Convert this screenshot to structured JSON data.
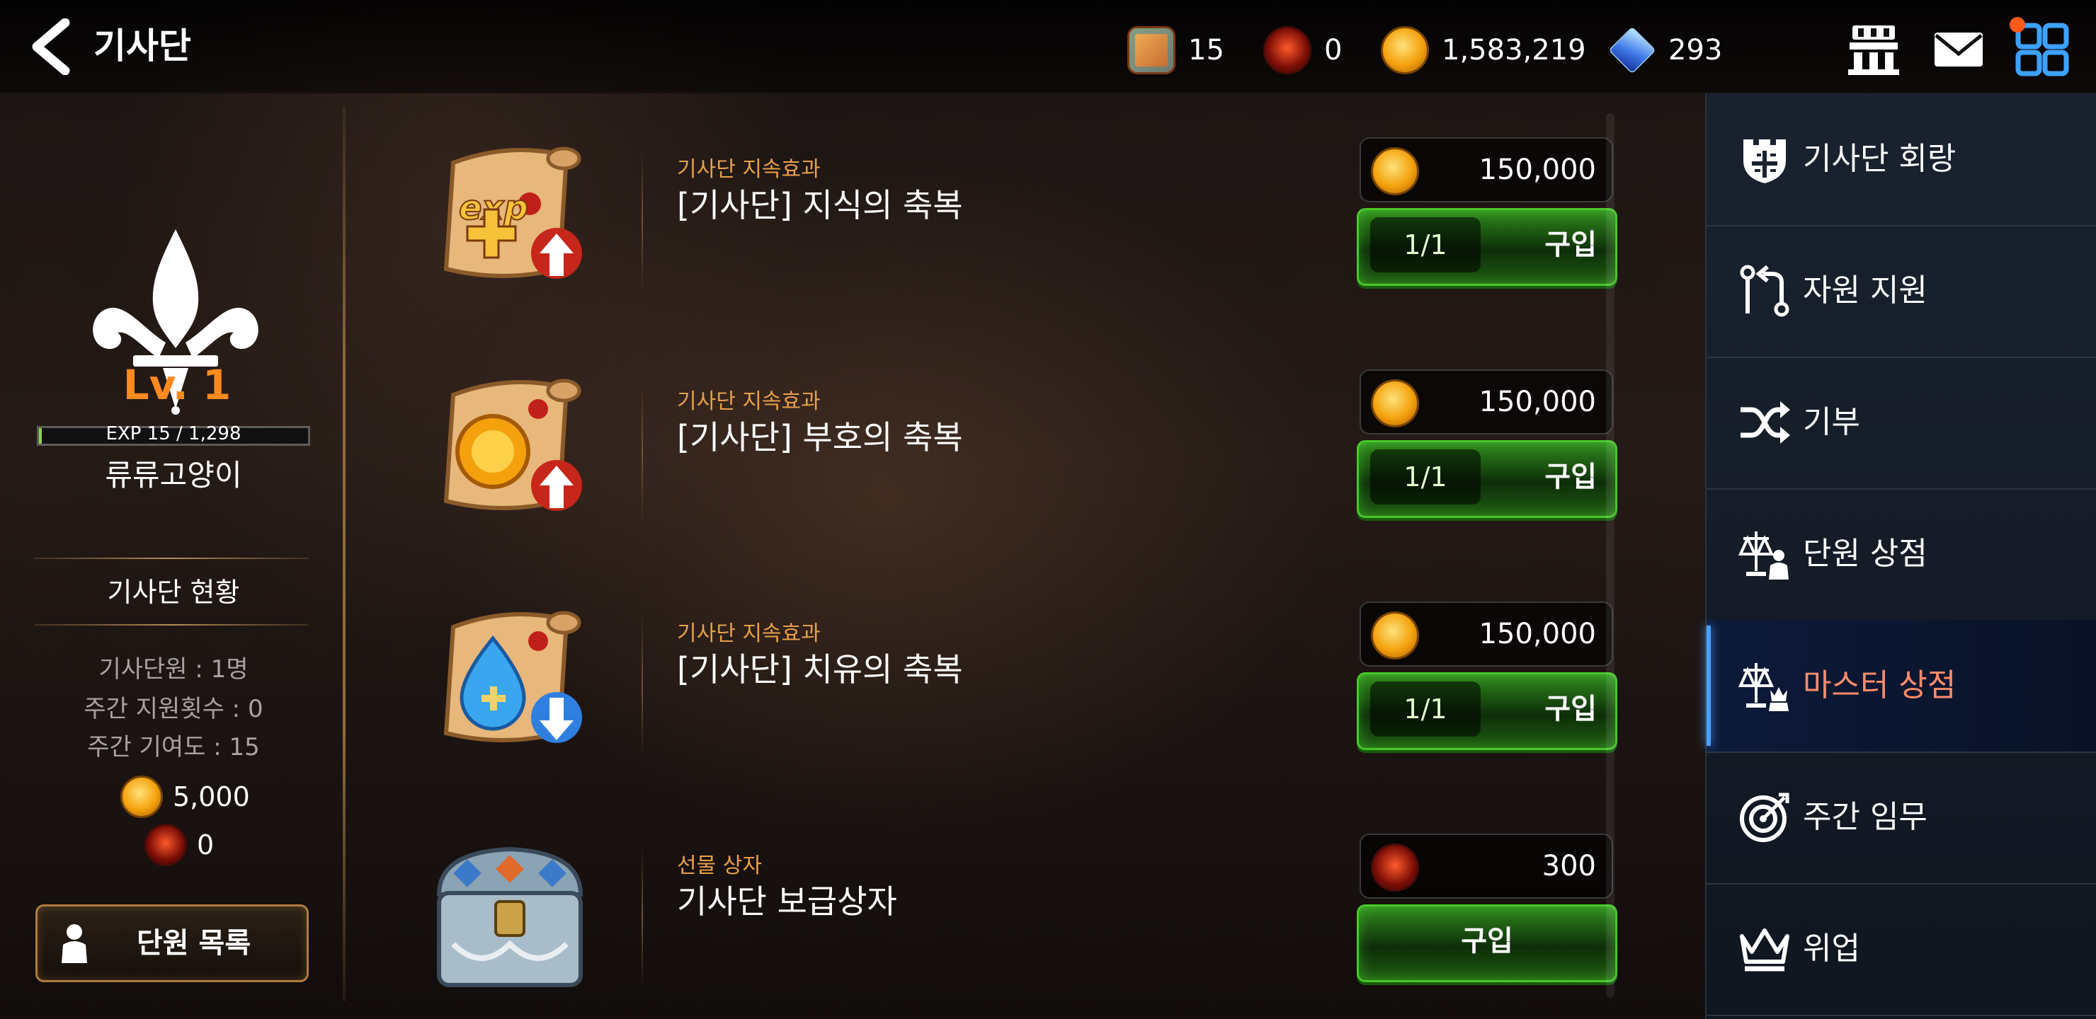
{
  "header": {
    "title": "기사단",
    "currencies": [
      {
        "icon": "treasure-box-icon",
        "value": "15"
      },
      {
        "icon": "flame-orb-icon",
        "value": "0"
      },
      {
        "icon": "gold-coin-icon",
        "value": "1,583,219"
      },
      {
        "icon": "blue-gem-icon",
        "value": "293"
      }
    ],
    "icons": [
      "guild-hall-icon",
      "mail-icon",
      "grid-menu-icon"
    ]
  },
  "left_panel": {
    "level": "Lv.  1",
    "exp_text": "EXP 15 / 1,298",
    "exp_fraction": 0.0116,
    "username": "류류고양이",
    "section_title": "기사단 현황",
    "stats": [
      "기사단원 : 1명",
      "주간 지원횟수 : 0",
      "주간 기여도 : 15"
    ],
    "gold": "5,000",
    "flame": "0",
    "member_button": "단원 목록"
  },
  "items": [
    {
      "category": "기사단 지속효과",
      "name": "[기사단] 지식의 축복",
      "price": "150,000",
      "price_icon": "gold-coin-icon",
      "count": "1/1",
      "buy": "구입",
      "icon": "exp-scroll-icon"
    },
    {
      "category": "기사단 지속효과",
      "name": "[기사단] 부호의 축복",
      "price": "150,000",
      "price_icon": "gold-coin-icon",
      "count": "1/1",
      "buy": "구입",
      "icon": "gold-scroll-icon"
    },
    {
      "category": "기사단 지속효과",
      "name": "[기사단] 치유의 축복",
      "price": "150,000",
      "price_icon": "gold-coin-icon",
      "count": "1/1",
      "buy": "구입",
      "icon": "heal-scroll-icon"
    },
    {
      "category": "선물 상자",
      "name": "기사단 보급상자",
      "price": "300",
      "price_icon": "flame-orb-icon",
      "buy": "구입",
      "icon": "supply-chest-icon"
    }
  ],
  "menu": [
    {
      "label": "기사단 회랑",
      "icon": "castle-shield-icon",
      "active": false
    },
    {
      "label": "자원 지원",
      "icon": "exchange-icon",
      "active": false
    },
    {
      "label": "기부",
      "icon": "shuffle-icon",
      "active": false
    },
    {
      "label": "단원 상점",
      "icon": "scale-person-icon",
      "active": false
    },
    {
      "label": "마스터 상점",
      "icon": "scale-crown-icon",
      "active": true
    },
    {
      "label": "주간 임무",
      "icon": "target-icon",
      "active": false
    },
    {
      "label": "위업",
      "icon": "crown-icon",
      "active": false
    }
  ],
  "colors": {
    "accent_orange": "#ff8a1e",
    "buy_green": "#48c82a",
    "active_menu": "#ff8c6b",
    "category": "#e8a04a"
  }
}
